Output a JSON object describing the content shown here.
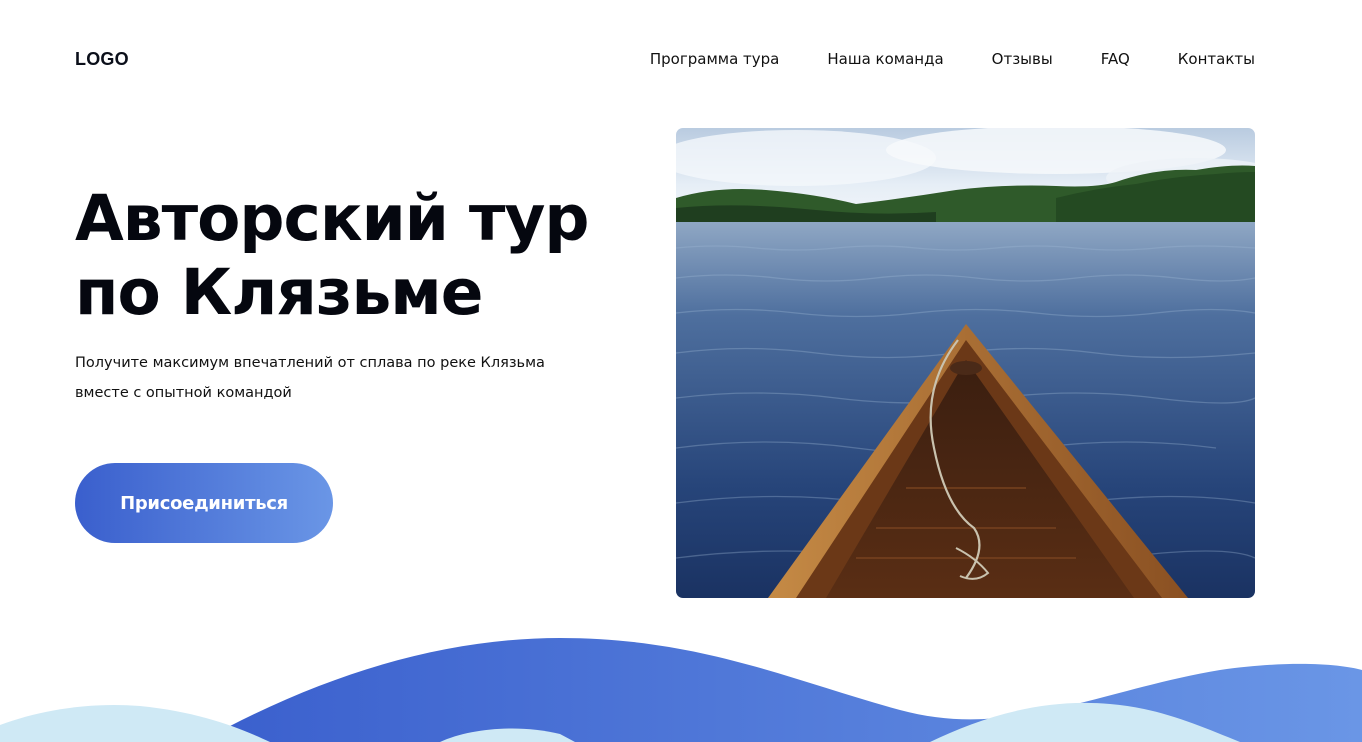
{
  "header": {
    "logo": "LOGO",
    "nav": [
      {
        "label": "Программа тура"
      },
      {
        "label": "Наша команда"
      },
      {
        "label": "Отзывы"
      },
      {
        "label": "FAQ"
      },
      {
        "label": "Контакты"
      }
    ]
  },
  "hero": {
    "title_line1": "Авторский тур",
    "title_line2": "по Клязьме",
    "subtitle_line1": "Получите максимум впечатлений от сплава по реке Клязьма",
    "subtitle_line2": "вместе с опытной командой",
    "cta_label": "Присоединиться"
  },
  "colors": {
    "accent_start": "#3a5fcd",
    "accent_end": "#6a96e6",
    "wave_light": "#cfe9f5"
  },
  "icons": {
    "hero_image": "canoe-on-lake-photo"
  }
}
